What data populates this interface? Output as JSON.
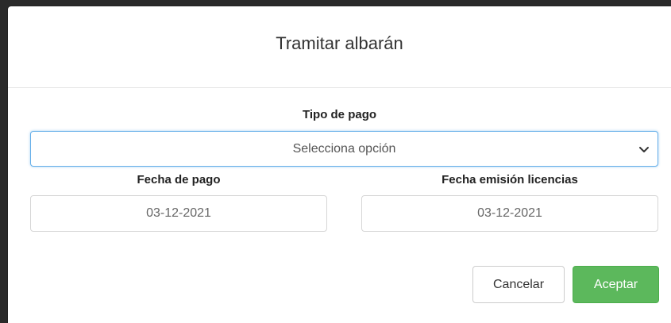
{
  "modal": {
    "title": "Tramitar albarán"
  },
  "tipo_pago": {
    "label": "Tipo de pago",
    "selected": "Selecciona opción",
    "icon": "chevron-down-icon"
  },
  "fecha_pago": {
    "label": "Fecha de pago",
    "value": "03-12-2021"
  },
  "fecha_emision": {
    "label": "Fecha emisión licencias",
    "value": "03-12-2021"
  },
  "buttons": {
    "cancel_label": "Cancelar",
    "accept_label": "Aceptar"
  },
  "colors": {
    "accept_bg": "#5cb85c",
    "focus_border": "#66afe9"
  }
}
